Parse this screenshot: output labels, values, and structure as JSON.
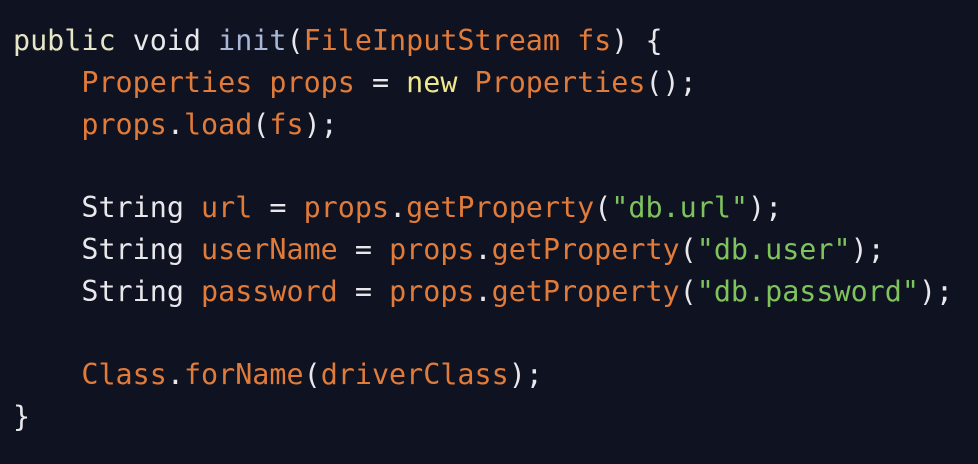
{
  "code_view": {
    "lines": [
      [
        {
          "text": "public",
          "color": "#e6e6c6"
        },
        {
          "text": " ",
          "color": "#e8e8ec"
        },
        {
          "text": "void",
          "color": "#e8e8ec"
        },
        {
          "text": " ",
          "color": "#e8e8ec"
        },
        {
          "text": "init",
          "color": "#a9b7d6"
        },
        {
          "text": "(",
          "color": "#e8e8ec"
        },
        {
          "text": "FileInputStream",
          "color": "#e07b39"
        },
        {
          "text": " ",
          "color": "#e8e8ec"
        },
        {
          "text": "fs",
          "color": "#e07b39"
        },
        {
          "text": ") {",
          "color": "#e8e8ec"
        }
      ],
      [
        {
          "text": "    ",
          "color": "#e8e8ec"
        },
        {
          "text": "Properties",
          "color": "#e07b39"
        },
        {
          "text": " ",
          "color": "#e8e8ec"
        },
        {
          "text": "props",
          "color": "#e07b39"
        },
        {
          "text": " = ",
          "color": "#e8e8ec"
        },
        {
          "text": "new",
          "color": "#f0e68c"
        },
        {
          "text": " ",
          "color": "#e8e8ec"
        },
        {
          "text": "Properties",
          "color": "#e07b39"
        },
        {
          "text": "();",
          "color": "#e8e8ec"
        }
      ],
      [
        {
          "text": "    ",
          "color": "#e8e8ec"
        },
        {
          "text": "props",
          "color": "#e07b39"
        },
        {
          "text": ".",
          "color": "#e8e8ec"
        },
        {
          "text": "load",
          "color": "#e07b39"
        },
        {
          "text": "(",
          "color": "#e8e8ec"
        },
        {
          "text": "fs",
          "color": "#e07b39"
        },
        {
          "text": ");",
          "color": "#e8e8ec"
        }
      ],
      [
        {
          "text": "",
          "color": "#e8e8ec"
        }
      ],
      [
        {
          "text": "    ",
          "color": "#e8e8ec"
        },
        {
          "text": "String",
          "color": "#e8e8ec"
        },
        {
          "text": " ",
          "color": "#e8e8ec"
        },
        {
          "text": "url",
          "color": "#e07b39"
        },
        {
          "text": " = ",
          "color": "#e8e8ec"
        },
        {
          "text": "props",
          "color": "#e07b39"
        },
        {
          "text": ".",
          "color": "#e8e8ec"
        },
        {
          "text": "getProperty",
          "color": "#e07b39"
        },
        {
          "text": "(",
          "color": "#e8e8ec"
        },
        {
          "text": "\"db.url\"",
          "color": "#7fc35c"
        },
        {
          "text": ");",
          "color": "#e8e8ec"
        }
      ],
      [
        {
          "text": "    ",
          "color": "#e8e8ec"
        },
        {
          "text": "String",
          "color": "#e8e8ec"
        },
        {
          "text": " ",
          "color": "#e8e8ec"
        },
        {
          "text": "userName",
          "color": "#e07b39"
        },
        {
          "text": " = ",
          "color": "#e8e8ec"
        },
        {
          "text": "props",
          "color": "#e07b39"
        },
        {
          "text": ".",
          "color": "#e8e8ec"
        },
        {
          "text": "getProperty",
          "color": "#e07b39"
        },
        {
          "text": "(",
          "color": "#e8e8ec"
        },
        {
          "text": "\"db.user\"",
          "color": "#7fc35c"
        },
        {
          "text": ");",
          "color": "#e8e8ec"
        }
      ],
      [
        {
          "text": "    ",
          "color": "#e8e8ec"
        },
        {
          "text": "String",
          "color": "#e8e8ec"
        },
        {
          "text": " ",
          "color": "#e8e8ec"
        },
        {
          "text": "password",
          "color": "#e07b39"
        },
        {
          "text": " = ",
          "color": "#e8e8ec"
        },
        {
          "text": "props",
          "color": "#e07b39"
        },
        {
          "text": ".",
          "color": "#e8e8ec"
        },
        {
          "text": "getProperty",
          "color": "#e07b39"
        },
        {
          "text": "(",
          "color": "#e8e8ec"
        },
        {
          "text": "\"db.password\"",
          "color": "#7fc35c"
        },
        {
          "text": ");",
          "color": "#e8e8ec"
        }
      ],
      [
        {
          "text": "",
          "color": "#e8e8ec"
        }
      ],
      [
        {
          "text": "    ",
          "color": "#e8e8ec"
        },
        {
          "text": "Class",
          "color": "#e07b39"
        },
        {
          "text": ".",
          "color": "#e8e8ec"
        },
        {
          "text": "forName",
          "color": "#e07b39"
        },
        {
          "text": "(",
          "color": "#e8e8ec"
        },
        {
          "text": "driverClass",
          "color": "#e07b39"
        },
        {
          "text": ");",
          "color": "#e8e8ec"
        }
      ],
      [
        {
          "text": "}",
          "color": "#e8e8ec"
        }
      ]
    ]
  },
  "colors": {
    "background": "#0f1221",
    "default_text": "#e8e8ec",
    "keyword": "#e6e6c6",
    "method_name": "#a9b7d6",
    "identifier": "#e07b39",
    "new_keyword": "#f0e68c",
    "string": "#7fc35c"
  }
}
